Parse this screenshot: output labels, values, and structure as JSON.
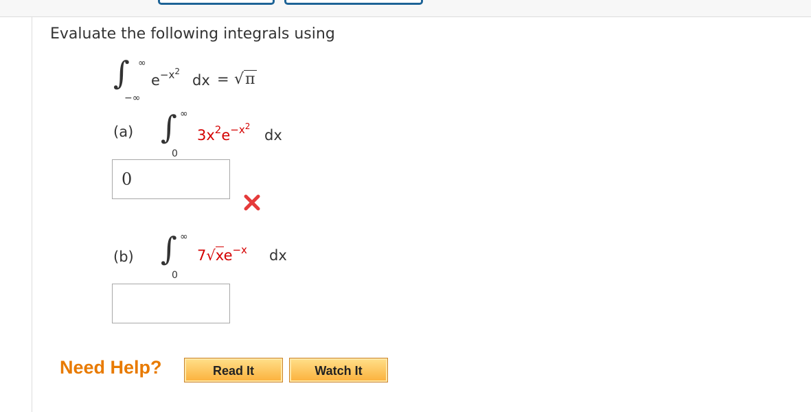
{
  "intro": "Evaluate the following integrals using",
  "given": {
    "upper": "∞",
    "lower": "−∞",
    "integrand_base": "e",
    "integrand_exp": "−x",
    "integrand_exp_pow": "2",
    "dx": "dx",
    "equals": "=",
    "rhs_radical": "√",
    "rhs_value": "π"
  },
  "part_a": {
    "label": "(a)",
    "upper": "∞",
    "lower": "0",
    "coef": "3x",
    "coef_pow": "2",
    "exp_base": "e",
    "exp_exp": "−x",
    "exp_pow": "2",
    "dx": "dx",
    "answer": "0",
    "status": "incorrect"
  },
  "part_b": {
    "label": "(b)",
    "upper": "∞",
    "lower": "0",
    "coef": "7",
    "radicand": "x",
    "exp_base": "e",
    "exp_exp": "−x",
    "dx": "dx",
    "answer": ""
  },
  "help": {
    "label": "Need Help?",
    "read_it": "Read It",
    "watch_it": "Watch It"
  },
  "colors": {
    "accent_tab": "#1d6396",
    "error": "#d40000",
    "help_text": "#e87a00",
    "button_fill": "#fbb03b"
  }
}
